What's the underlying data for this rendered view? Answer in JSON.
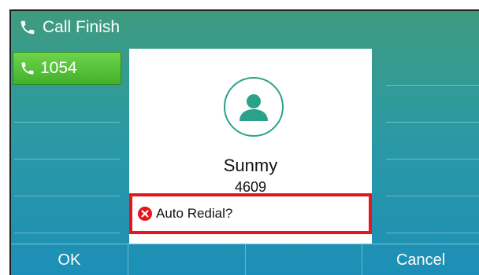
{
  "header": {
    "title": "Call Finish",
    "icon": "phone-icon"
  },
  "line_key": {
    "label": "1054",
    "icon": "phone-icon",
    "color": "#43b12b"
  },
  "contact": {
    "name": "Sunmy",
    "number": "4609",
    "avatar_icon": "user-avatar-icon"
  },
  "prompt": {
    "text": "Auto Redial?",
    "icon": "error-circle-icon",
    "highlight_color": "#e8141d"
  },
  "softkeys": [
    "OK",
    "",
    "",
    "Cancel"
  ],
  "colors": {
    "accent": "#2aa28a",
    "background_top": "#3f9b80",
    "background_bottom": "#1b8fb7"
  }
}
